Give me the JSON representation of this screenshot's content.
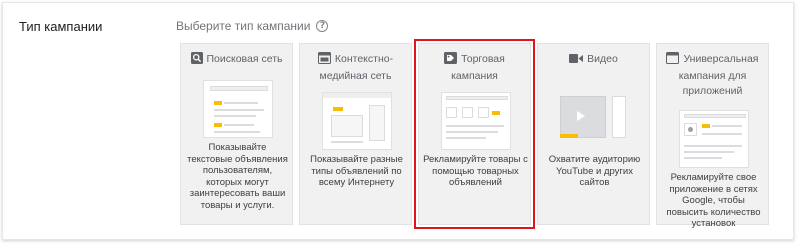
{
  "section": {
    "label": "Тип кампании",
    "prompt": "Выберите тип кампании",
    "help_icon": "?"
  },
  "cards": [
    {
      "title": "Поисковая сеть",
      "icon": "search-icon",
      "description": "Показывайте текстовые объявления пользователям, которых могут заинтересовать ваши товары и услуги.",
      "selected": false
    },
    {
      "title": "Контекстно-медийная сеть",
      "icon": "display-icon",
      "description": "Показывайте разные типы объявлений по всему Интернету",
      "selected": false
    },
    {
      "title": "Торговая кампания",
      "icon": "tag-icon",
      "description": "Рекламируйте товары с помощью товарных объявлений",
      "selected": true
    },
    {
      "title": "Видео",
      "icon": "video-icon",
      "description": "Охватите аудиторию YouTube и других сайтов",
      "selected": false
    },
    {
      "title": "Универсальная кампания для приложений",
      "icon": "app-icon",
      "description": "Рекламируйте свое приложение в сетях Google, чтобы повысить количество установок",
      "selected": false
    }
  ],
  "colors": {
    "selected_outline": "#e0141f",
    "illustration_accent": "#fbbc04",
    "card_background": "#f1f1f1"
  }
}
